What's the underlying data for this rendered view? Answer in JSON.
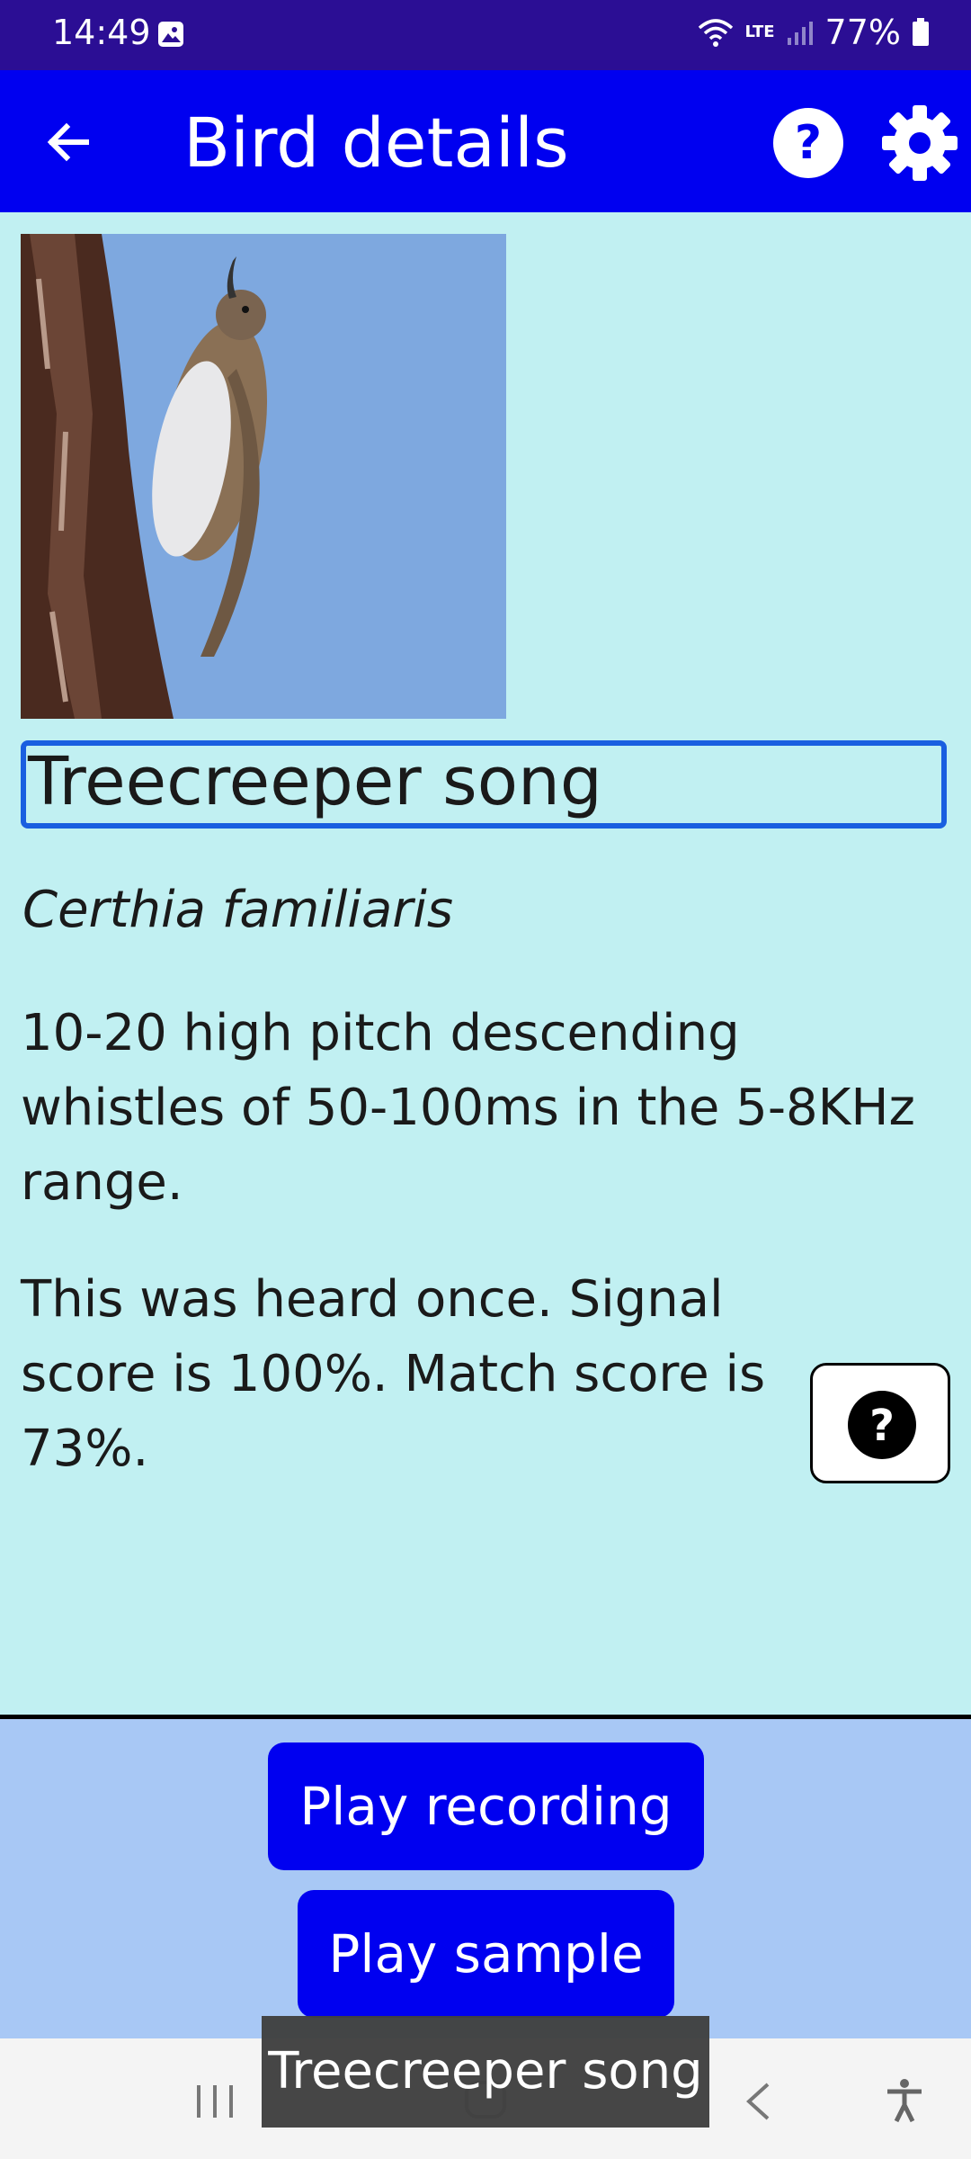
{
  "status_bar": {
    "time": "14:49",
    "network": "LTE",
    "battery": "77%"
  },
  "app_bar": {
    "title": "Bird details"
  },
  "bird": {
    "song_title": "Treecreeper song",
    "latin_name": "Certhia familiaris",
    "description": "10-20 high pitch descending whistles of 50-100ms in the 5-8KHz range.",
    "stats": "This was heard once. Signal score is 100%. Match score is 73%."
  },
  "buttons": {
    "play_recording": "Play recording",
    "play_sample": "Play sample"
  },
  "toast": "Treecreeper song",
  "colors": {
    "status_bar": "#2b0e94",
    "app_bar": "#0000f0",
    "content_bg": "#c1f0f2",
    "bottom_panel": "#a8c8f5",
    "button": "#0000f0",
    "focus_border": "#1a5fe0"
  },
  "icons": [
    "back-arrow-icon",
    "help-icon",
    "gear-icon",
    "gallery-icon",
    "wifi-icon",
    "signal-icon",
    "battery-icon",
    "accessibility-icon"
  ]
}
